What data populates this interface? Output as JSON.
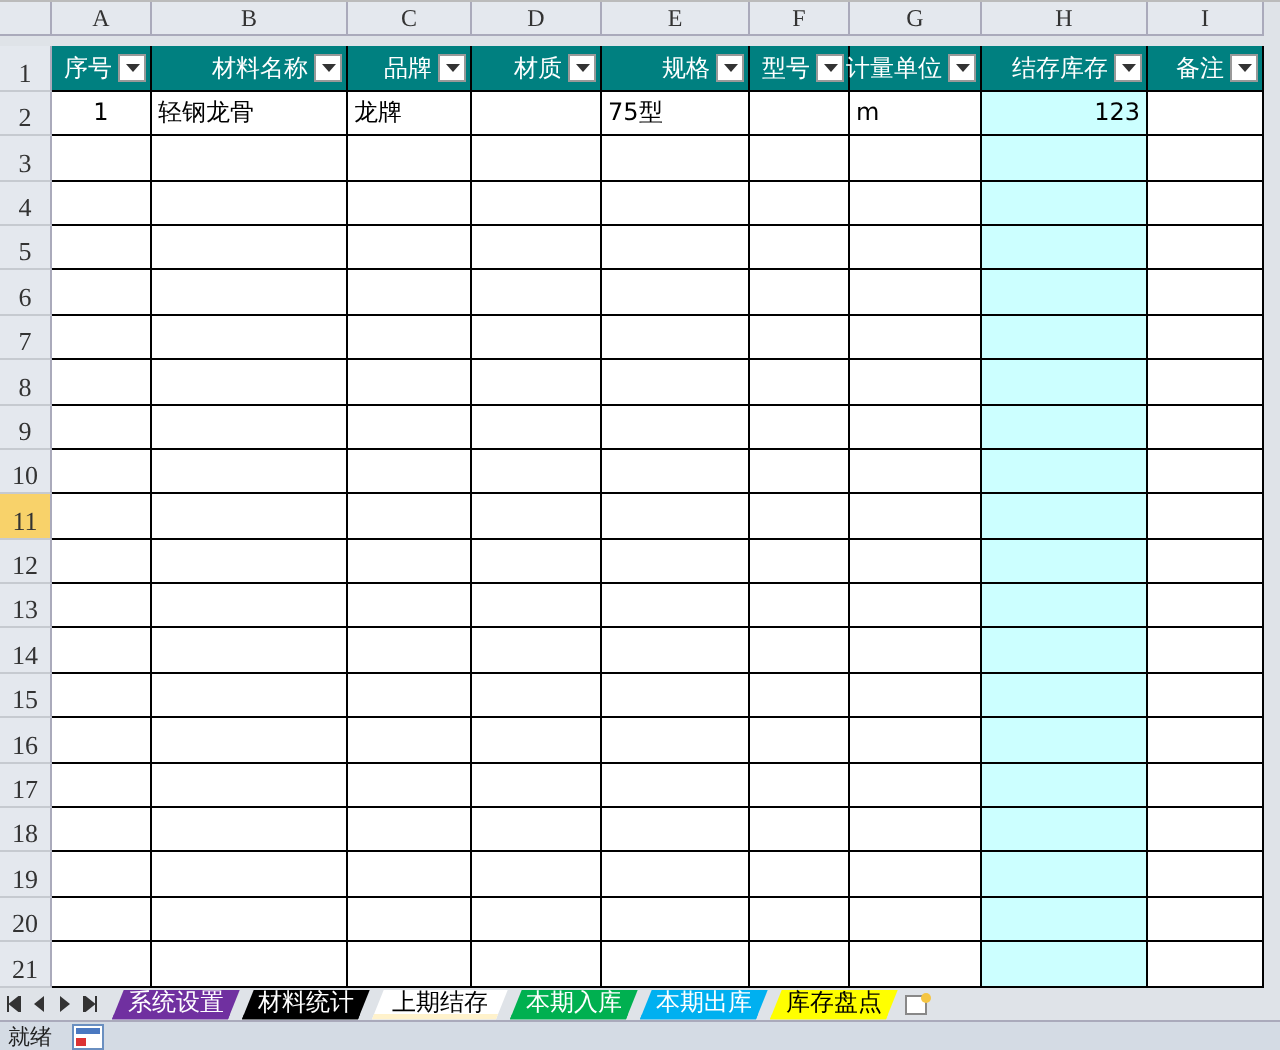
{
  "columns": [
    {
      "letter": "A",
      "label": "序号",
      "filter": true,
      "kind": "index",
      "highlighted": false
    },
    {
      "letter": "B",
      "label": "材料名称",
      "filter": true,
      "kind": "text",
      "highlighted": false
    },
    {
      "letter": "C",
      "label": "品牌",
      "filter": true,
      "kind": "text",
      "highlighted": false
    },
    {
      "letter": "D",
      "label": "材质",
      "filter": true,
      "kind": "text",
      "highlighted": false
    },
    {
      "letter": "E",
      "label": "规格",
      "filter": true,
      "kind": "text",
      "highlighted": false
    },
    {
      "letter": "F",
      "label": "型号",
      "filter": true,
      "kind": "text",
      "highlighted": false
    },
    {
      "letter": "G",
      "label": "计量单位",
      "filter": true,
      "kind": "text",
      "highlighted": false
    },
    {
      "letter": "H",
      "label": "结存库存",
      "filter": true,
      "kind": "number",
      "highlighted": true
    },
    {
      "letter": "I",
      "label": "备注",
      "filter": true,
      "kind": "text",
      "highlighted": false
    }
  ],
  "header_row": {
    "number": "1",
    "selected": false
  },
  "rows": [
    {
      "number": "2",
      "selected": false,
      "values": {
        "A": "1",
        "B": "轻钢龙骨",
        "C": "龙牌",
        "E": "75型",
        "G": "m",
        "H": "123"
      }
    },
    {
      "number": "3",
      "selected": false
    },
    {
      "number": "4",
      "selected": false
    },
    {
      "number": "5",
      "selected": false
    },
    {
      "number": "6",
      "selected": false
    },
    {
      "number": "7",
      "selected": false
    },
    {
      "number": "8",
      "selected": false
    },
    {
      "number": "9",
      "selected": false
    },
    {
      "number": "10",
      "selected": false
    },
    {
      "number": "11",
      "selected": true
    },
    {
      "number": "12",
      "selected": false
    },
    {
      "number": "13",
      "selected": false
    },
    {
      "number": "14",
      "selected": false
    },
    {
      "number": "15",
      "selected": false
    },
    {
      "number": "16",
      "selected": false
    },
    {
      "number": "17",
      "selected": false
    },
    {
      "number": "18",
      "selected": false
    },
    {
      "number": "19",
      "selected": false
    },
    {
      "number": "20",
      "selected": false
    },
    {
      "number": "21",
      "selected": false
    }
  ],
  "sheet_tabs": [
    {
      "label": "系统设置",
      "color": "#7030a0",
      "selected": false
    },
    {
      "label": "材料统计",
      "color": "#000000",
      "selected": false
    },
    {
      "label": "上期结存",
      "color": "#fff2cc",
      "selected": true
    },
    {
      "label": "本期入库",
      "color": "#00b050",
      "selected": false
    },
    {
      "label": "本期出库",
      "color": "#00b0f0",
      "selected": false
    },
    {
      "label": "库存盘点",
      "color": "#ffff00",
      "selected": false
    }
  ],
  "status_bar": {
    "text": "就绪"
  }
}
